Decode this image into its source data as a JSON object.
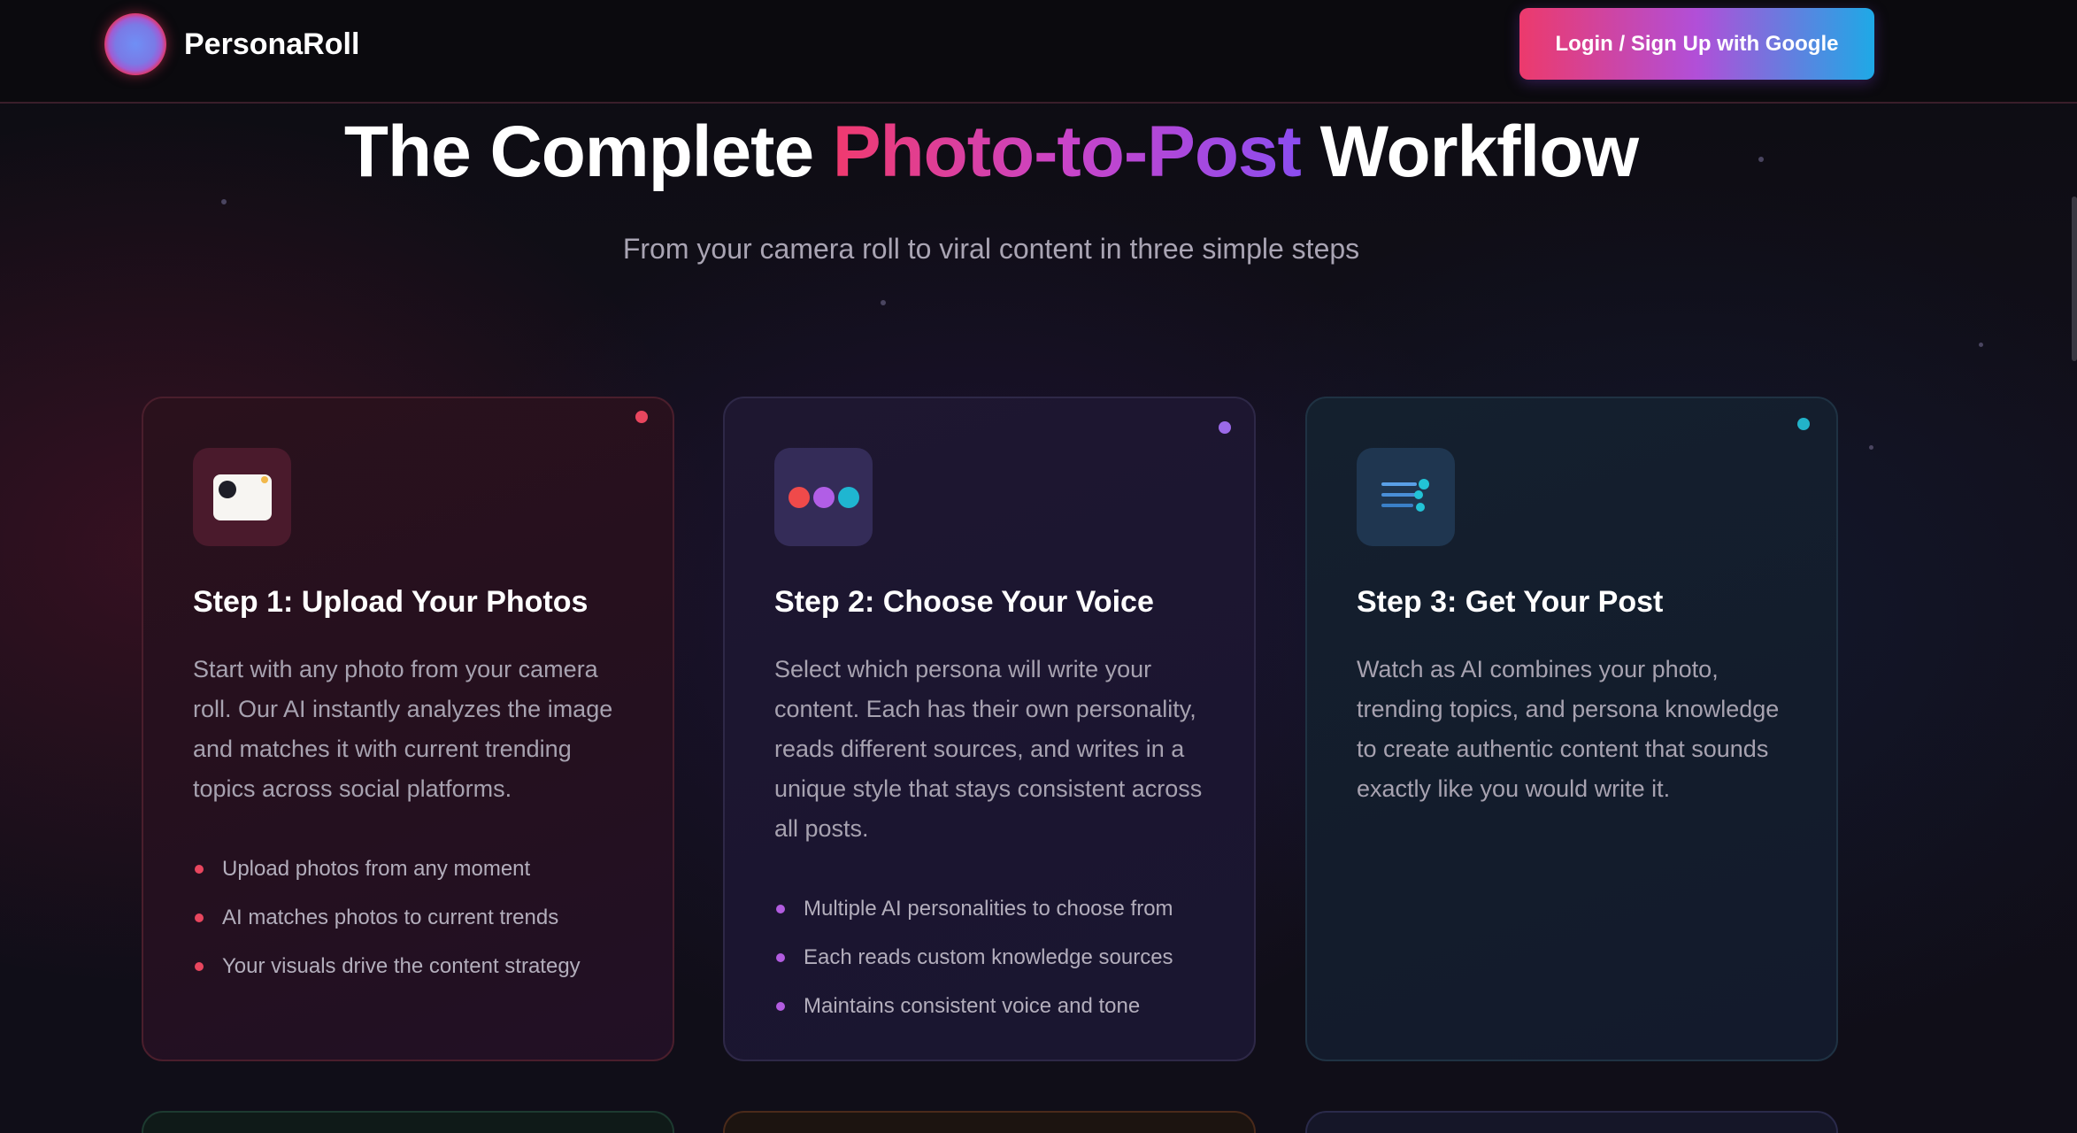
{
  "header": {
    "brand": "PersonaRoll",
    "login_button": "Login / Sign Up with Google"
  },
  "hero": {
    "title_start": "The Complete ",
    "title_highlight": "Photo-to-Post",
    "title_end": " Workflow",
    "subtitle": "From your camera roll to viral content in three simple steps"
  },
  "steps": [
    {
      "title": "Step 1: Upload Your Photos",
      "icon": "photo-camera-icon",
      "accent": "#e8465e",
      "description": "Start with any photo from your camera roll. Our AI instantly analyzes the image and matches it with current trending topics across social platforms.",
      "points": [
        "Upload photos from any moment",
        "AI matches photos to current trends",
        "Your visuals drive the content strategy"
      ]
    },
    {
      "title": "Step 2: Choose Your Voice",
      "icon": "persona-dots-icon",
      "accent": "#b25ce0",
      "description": "Select which persona will write your content. Each has their own personality, reads different sources, and writes in a unique style that stays consistent across all posts.",
      "points": [
        "Multiple AI personalities to choose from",
        "Each reads custom knowledge sources",
        "Maintains consistent voice and tone"
      ]
    },
    {
      "title": "Step 3: Get Your Post",
      "icon": "content-lines-icon",
      "accent": "#22b3c9",
      "description": "Watch as AI combines your photo, trending topics, and persona knowledge to create authentic content that sounds exactly like you would write it.",
      "points": []
    }
  ]
}
